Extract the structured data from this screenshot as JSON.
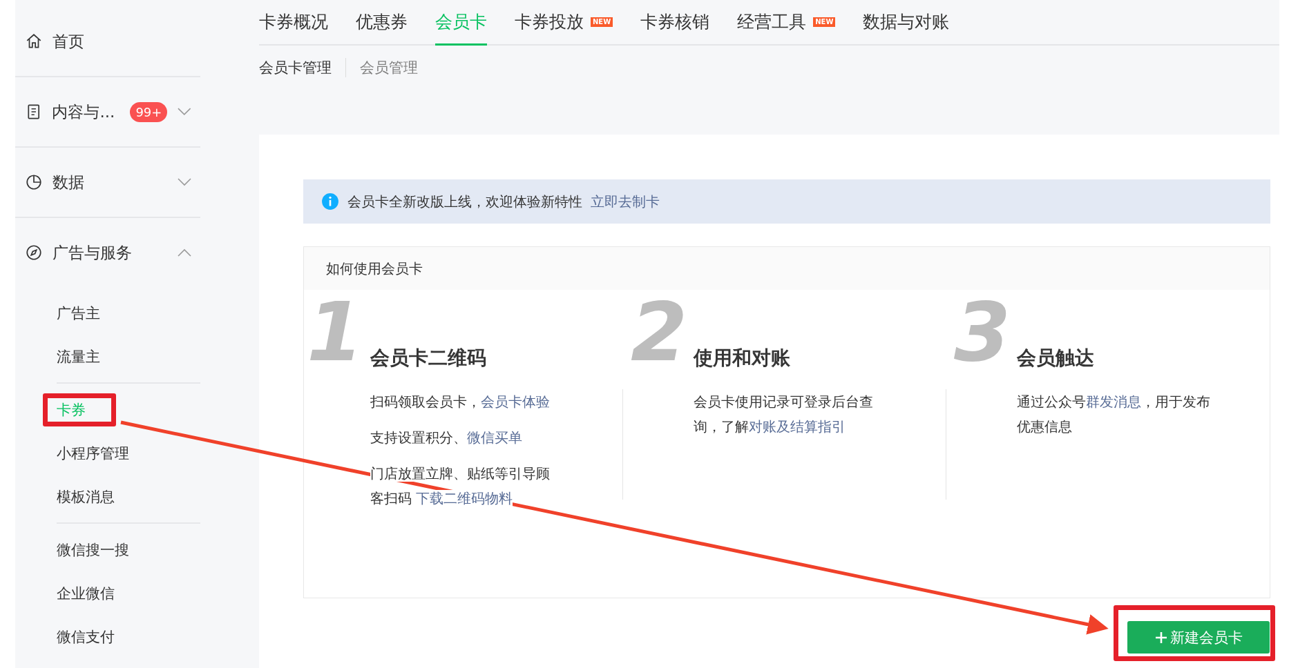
{
  "sidebar": {
    "groups": [
      {
        "label": "首页",
        "kind": "home"
      },
      {
        "label": "内容与...",
        "kind": "document",
        "badge": "99+",
        "expanded": false
      },
      {
        "label": "数据",
        "kind": "chart",
        "expanded": false
      },
      {
        "label": "广告与服务",
        "kind": "compass",
        "expanded": true,
        "child_groups": [
          {
            "items": [
              {
                "label": "广告主",
                "selected": false,
                "highlighted": false
              },
              {
                "label": "流量主",
                "selected": false,
                "highlighted": false
              }
            ]
          },
          {
            "items": [
              {
                "label": "卡券",
                "selected": true,
                "highlighted": true
              },
              {
                "label": "小程序管理",
                "selected": false,
                "highlighted": false
              },
              {
                "label": "模板消息",
                "selected": false,
                "highlighted": false
              }
            ]
          },
          {
            "items": [
              {
                "label": "微信搜一搜",
                "selected": false,
                "highlighted": false
              },
              {
                "label": "企业微信",
                "selected": false,
                "highlighted": false
              },
              {
                "label": "微信支付",
                "selected": false,
                "highlighted": false
              }
            ]
          }
        ]
      }
    ]
  },
  "tabs": [
    {
      "label": "卡券概况",
      "selected": false
    },
    {
      "label": "优惠券",
      "selected": false
    },
    {
      "label": "会员卡",
      "selected": true
    },
    {
      "label": "卡券投放",
      "selected": false,
      "badge": "NEW"
    },
    {
      "label": "卡券核销",
      "selected": false
    },
    {
      "label": "经营工具",
      "selected": false,
      "badge": "NEW"
    },
    {
      "label": "数据与对账",
      "selected": false
    }
  ],
  "subtabs": [
    {
      "label": "会员卡管理",
      "selected": true
    },
    {
      "label": "会员管理",
      "selected": false
    }
  ],
  "notice": {
    "text": "会员卡全新改版上线，欢迎体验新特性",
    "link": "立即去制卡"
  },
  "guide": {
    "title": "如何使用会员卡",
    "steps": [
      {
        "number": "1",
        "title": "会员卡二维码",
        "paragraphs": [
          [
            {
              "text": "扫码领取会员卡，",
              "link": false
            },
            {
              "text": "会员卡体验",
              "link": true
            }
          ],
          [
            {
              "text": "支持设置积分、",
              "link": false
            },
            {
              "text": "微信买单",
              "link": true
            }
          ],
          [
            {
              "text": "门店放置立牌、贴纸等引导顾客扫码 ",
              "link": false
            },
            {
              "text": "下载二维码物料",
              "link": true
            }
          ]
        ]
      },
      {
        "number": "2",
        "title": "使用和对账",
        "paragraphs": [
          [
            {
              "text": "会员卡使用记录可登录后台查询，了解",
              "link": false
            },
            {
              "text": "对账及结算指引",
              "link": true
            }
          ]
        ]
      },
      {
        "number": "3",
        "title": "会员触达",
        "paragraphs": [
          [
            {
              "text": "通过公众号",
              "link": false
            },
            {
              "text": "群发消息",
              "link": true
            },
            {
              "text": "，用于发布优惠信息",
              "link": false
            }
          ]
        ]
      }
    ]
  },
  "create_button": {
    "label": "新建会员卡",
    "highlighted": true
  },
  "callout_arrow": true
}
